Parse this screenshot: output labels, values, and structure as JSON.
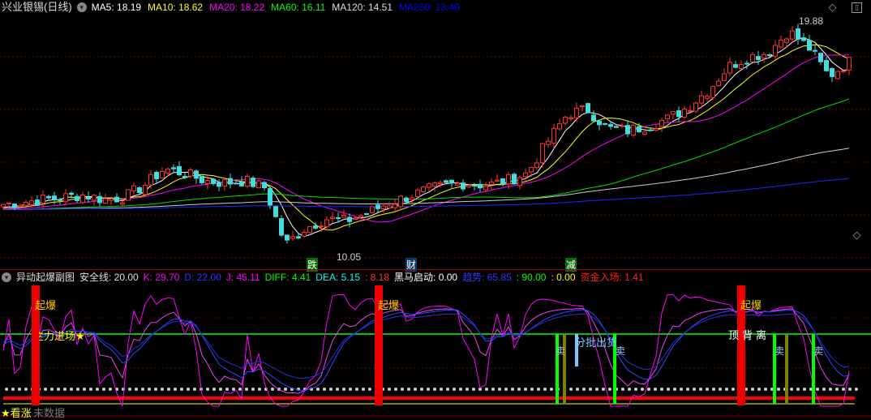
{
  "header": {
    "title": "兴业银锡(日线)",
    "ma": [
      {
        "label": "MA5: 18.19",
        "color": "#ffffff"
      },
      {
        "label": "MA10: 18.62",
        "color": "#ffff00"
      },
      {
        "label": "MA20: 18.22",
        "color": "#ff00ff"
      },
      {
        "label": "MA60: 16.11",
        "color": "#00ff00"
      },
      {
        "label": "MA120: 14.51",
        "color": "#dddddd"
      },
      {
        "label": "MA250: 13.40",
        "color": "#0000ff"
      }
    ]
  },
  "price_chart": {
    "high_label": "19.88",
    "low_label": "10.05",
    "markers": [
      "跌",
      "财",
      "减"
    ]
  },
  "indicator": {
    "title": "异动起爆副图",
    "items": [
      {
        "label": "安全线: 20.00",
        "color": "#dddddd"
      },
      {
        "label": "K: 29.70",
        "color": "#ff00ff"
      },
      {
        "label": "D: 22.00",
        "color": "#3333ff"
      },
      {
        "label": "J: 45.11",
        "color": "#ff00ff"
      },
      {
        "label": "DIFF: 4.41",
        "color": "#00ff00"
      },
      {
        "label": "DEA: 5.15",
        "color": "#00ffff"
      },
      {
        "label": ": 8.18",
        "color": "#ff3333"
      },
      {
        "label": "黑马启动: 0.00",
        "color": "#ffffff"
      },
      {
        "label": "趋势: 65.85",
        "color": "#3333ff"
      },
      {
        "label": ": 90.00",
        "color": "#00ff00"
      },
      {
        "label": ": 0.00",
        "color": "#ffff00"
      },
      {
        "label": "资金入场: 1.41",
        "color": "#ff2222"
      }
    ],
    "signals": {
      "burst": "起爆",
      "main_force": "主力进场★",
      "sell": "卖",
      "batch_sell": "分批出货",
      "top_div": "顶背离",
      "bullish": "★看涨",
      "no_data": "未数据"
    }
  },
  "chart_data": {
    "type": "candlestick",
    "y_range": [
      10.05,
      19.88
    ],
    "keypoints": [
      12.2,
      12.3,
      12.4,
      12.5,
      12.6,
      12.4,
      12.5,
      13.0,
      13.7,
      13.5,
      13.2,
      13.1,
      13.2,
      12.9,
      10.5,
      11.2,
      11.6,
      11.5,
      11.8,
      12.2,
      12.5,
      12.8,
      13.0,
      13.1,
      13.0,
      13.2,
      13.5,
      14.8,
      16.0,
      16.2,
      15.4,
      15.3,
      15.5,
      15.8,
      16.3,
      17.0,
      18.0,
      18.4,
      18.6,
      19.5,
      18.8,
      17.6,
      18.2
    ],
    "ma_periods": [
      5,
      10,
      20,
      60,
      120,
      250
    ]
  }
}
